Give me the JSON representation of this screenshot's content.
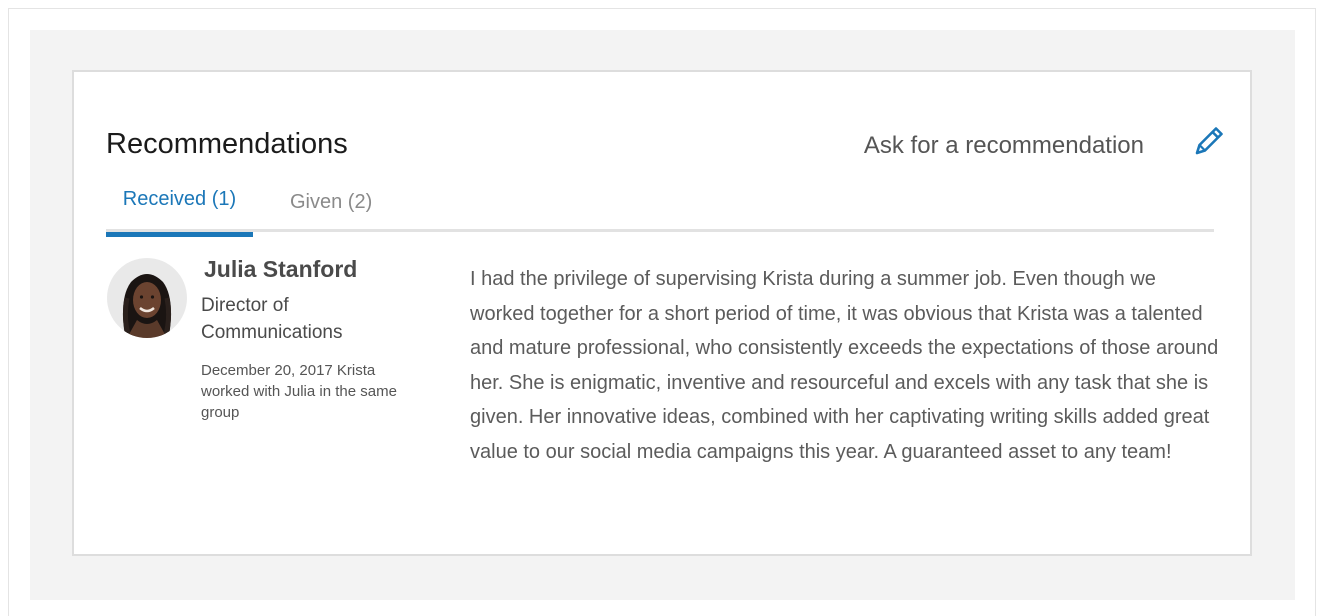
{
  "recommendations": {
    "title": "Recommendations",
    "ask_link": "Ask for a recommendation",
    "edit_icon": "pencil-icon",
    "accent_color": "#1b77b8",
    "tabs": [
      {
        "label": "Received (1)",
        "active": true
      },
      {
        "label": "Given (2)",
        "active": false
      }
    ],
    "received": [
      {
        "name": "Julia Stanford",
        "title": "Director of Communications",
        "meta": "December 20, 2017 Krista worked with Julia in the same group",
        "text": "I had the privilege of supervising Krista during a summer job. Even though we worked together for a short period of time, it was obvious that Krista was a talented and mature professional, who consistently exceeds the expectations of those around her. She is enigmatic, inventive and resourceful and excels with any task that she is given. Her innovative ideas, combined with her captivating writing skills added great value to our social media campaigns this year. A guaranteed asset to any team!"
      }
    ]
  }
}
